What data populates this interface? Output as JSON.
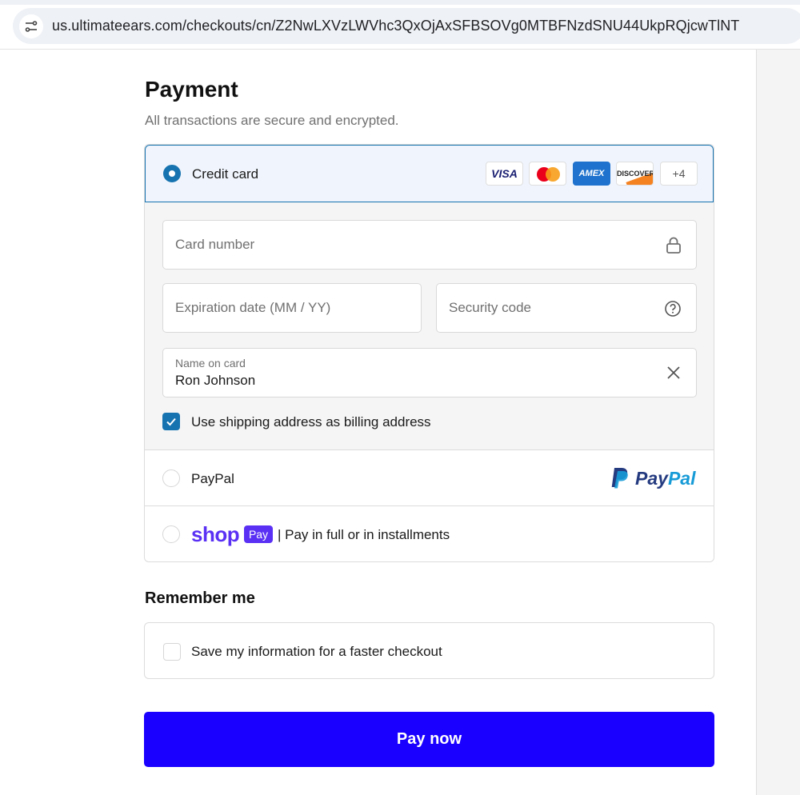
{
  "browser": {
    "url": "us.ultimateears.com/checkouts/cn/Z2NwLXVzLWVhc3QxOjAxSFBSOVg0MTBFNzdSNU44UkpRQjcwTlNT"
  },
  "payment": {
    "title": "Payment",
    "subtitle": "All transactions are secure and encrypted.",
    "credit_card": {
      "label": "Credit card",
      "selected": true,
      "brands": [
        "VISA",
        "AMEX",
        "DISCOVER"
      ],
      "more_brands": "+4",
      "card_number_placeholder": "Card number",
      "expiration_placeholder": "Expiration date (MM / YY)",
      "security_code_placeholder": "Security code",
      "name_label": "Name on card",
      "name_value": "Ron Johnson",
      "billing_label": "Use shipping address as billing address",
      "billing_checked": true
    },
    "paypal": {
      "label": "PayPal",
      "logo_part1": "Pay",
      "logo_part2": "Pal"
    },
    "shop_pay": {
      "word": "shop",
      "badge": "Pay",
      "label": "| Pay in full or in installments"
    }
  },
  "remember": {
    "title": "Remember me",
    "save_label": "Save my information for a faster checkout",
    "checked": false
  },
  "pay_button": "Pay now",
  "colors": {
    "accent": "#1773b0",
    "pay_button": "#1a00ff",
    "shop_pay": "#5a31f4"
  }
}
